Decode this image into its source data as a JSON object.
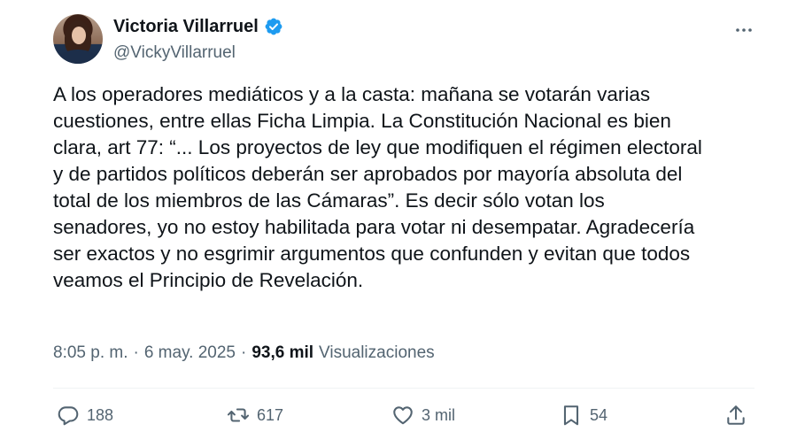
{
  "author": {
    "display_name": "Victoria Villarruel",
    "handle": "@VickyVillarruel",
    "verified": true
  },
  "tweet": {
    "text": "A los operadores mediáticos y a la casta: mañana se votarán varias\ncuestiones, entre ellas Ficha Limpia. La Constitución Nacional es bien\nclara, art 77: “... Los proyectos de ley que modifiquen el régimen electoral\ny de partidos políticos deberán ser aprobados por mayoría absoluta del\ntotal de los miembros de las Cámaras”. Es decir sólo votan los\nsenadores, yo no estoy habilitada para votar ni desempatar.  Agradecería\nser exactos y no esgrimir argumentos que confunden y evitan que todos\nveamos el Principio de Revelación."
  },
  "meta": {
    "time": "8:05 p. m.",
    "date": "6 may. 2025",
    "separator": "·",
    "views_count": "93,6 mil",
    "views_label": "Visualizaciones"
  },
  "actions": {
    "reply_count": "188",
    "retweet_count": "617",
    "like_count": "3 mil",
    "bookmark_count": "54"
  },
  "icons": {
    "verified": "verified-badge-icon",
    "more": "more-dots-icon",
    "reply": "reply-icon",
    "retweet": "retweet-icon",
    "like": "heart-icon",
    "bookmark": "bookmark-icon",
    "share": "share-icon"
  },
  "colors": {
    "text": "#0f1419",
    "secondary": "#536471",
    "verified": "#1d9bf0",
    "divider": "#eff3f4"
  }
}
